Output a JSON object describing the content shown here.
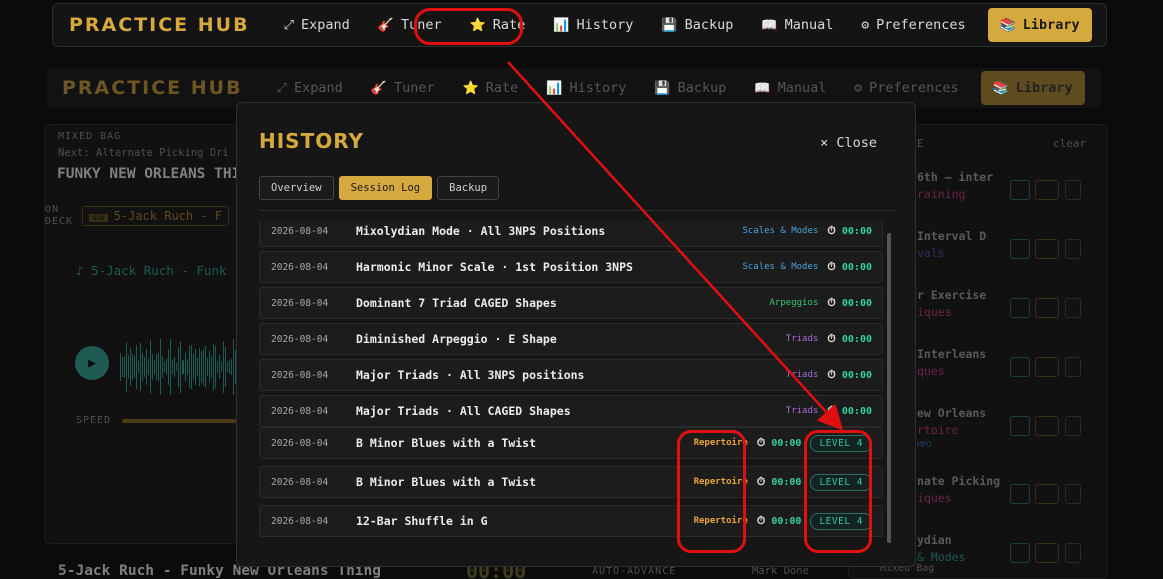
{
  "app": {
    "brand": "PRACTICE HUB"
  },
  "nav": [
    {
      "label": "Expand",
      "icon": "expand-arrows-icon",
      "glyph": "⤢"
    },
    {
      "label": "Tuner",
      "icon": "guitar-icon",
      "glyph": "🎸"
    },
    {
      "label": "Rate",
      "icon": "star-icon",
      "glyph": "⭐"
    },
    {
      "label": "History",
      "icon": "bar-chart-icon",
      "glyph": "📊"
    },
    {
      "label": "Backup",
      "icon": "floppy-disk-icon",
      "glyph": "💾"
    },
    {
      "label": "Manual",
      "icon": "book-icon",
      "glyph": "📖"
    },
    {
      "label": "Preferences",
      "icon": "gear-icon",
      "glyph": "⚙"
    },
    {
      "label": "Library",
      "icon": "books-icon",
      "glyph": "📚"
    }
  ],
  "background": {
    "mixed_bag": "MIXED BAG",
    "next_label": "Next:",
    "next_value": "Alternate Picking Dri",
    "current_title": "FUNKY NEW ORLEANS THING",
    "on_deck": "ON DECK",
    "now_badge": "NOW",
    "on_deck_item": "5-Jack Ruch - F",
    "player_title": "♪ 5-Jack Ruch - Funk",
    "speed_label": "SPEED",
    "footer_title": "5-Jack Ruch - Funky New Orleans Thing",
    "footer_timer": "00:00",
    "auto_advance": "AUTO-ADVANCE",
    "mark_done": "Mark Done",
    "queue_header": "E",
    "clear": "clear",
    "queue": [
      {
        "title": "6th — inter",
        "category": "raining"
      },
      {
        "title": "Interval D",
        "category": "vals"
      },
      {
        "title": "r Exercise",
        "category": "iques"
      },
      {
        "title": "Interleans",
        "category": "ques"
      },
      {
        "title": "ew Orleans",
        "category": "rtoire",
        "tag": "MPO"
      },
      {
        "title": "nate Picking",
        "category": "iques"
      },
      {
        "title": "ydian",
        "category": "& Modes",
        "bag": "Mixed Bag"
      }
    ]
  },
  "modal": {
    "title": "HISTORY",
    "close_label": "Close",
    "close_glyph": "×",
    "tabs": [
      {
        "label": "Overview",
        "active": false
      },
      {
        "label": "Session Log",
        "active": true
      },
      {
        "label": "Backup",
        "active": false
      }
    ],
    "log": [
      {
        "date": "2026-08-04",
        "name": "Mixolydian Mode · All 3NPS Positions",
        "category": "Scales & Modes",
        "cat_class": "cat-blue",
        "time": "00:00"
      },
      {
        "date": "2026-08-04",
        "name": "Harmonic Minor Scale · 1st Position 3NPS",
        "category": "Scales & Modes",
        "cat_class": "cat-blue",
        "time": "00:00"
      },
      {
        "date": "2026-08-04",
        "name": "Dominant 7 Triad CAGED Shapes",
        "category": "Arpeggios",
        "cat_class": "cat-green",
        "time": "00:00"
      },
      {
        "date": "2026-08-04",
        "name": "Diminished Arpeggio · E Shape",
        "category": "Triads",
        "cat_class": "cat-purple",
        "time": "00:00"
      },
      {
        "date": "2026-08-04",
        "name": "Major Triads · All 3NPS positions",
        "category": "Triads",
        "cat_class": "cat-purple",
        "time": "00:00"
      },
      {
        "date": "2026-08-04",
        "name": "Major Triads · All CAGED Shapes",
        "category": "Triads",
        "cat_class": "cat-purple",
        "time": "00:00"
      },
      {
        "date": "2026-08-04",
        "name": "B Minor Blues with a Twist",
        "category": "Repertoire",
        "cat_class": "cat-orange",
        "time": "00:00",
        "level": "LEVEL 4"
      },
      {
        "date": "2026-08-04",
        "name": "B Minor Blues with a Twist",
        "category": "Repertoire",
        "cat_class": "cat-orange",
        "time": "00:00",
        "level": "LEVEL 4"
      },
      {
        "date": "2026-08-04",
        "name": "12-Bar Shuffle in G",
        "category": "Repertoire",
        "cat_class": "cat-orange",
        "time": "00:00",
        "level": "LEVEL 4"
      }
    ]
  },
  "colors": {
    "accent": "#d6a93f",
    "teal": "#35d09c",
    "annotation": "#e01010"
  }
}
